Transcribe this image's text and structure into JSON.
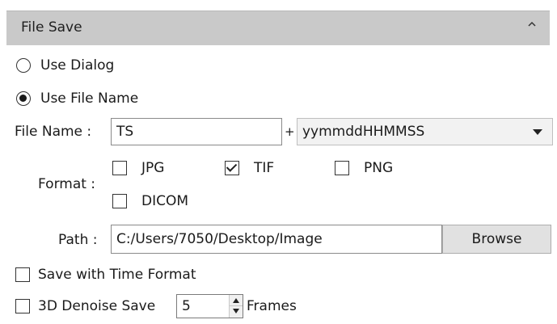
{
  "panel": {
    "title": "File Save",
    "collapse_icon": "chevron-up-icon"
  },
  "save_mode": {
    "options": [
      {
        "label": "Use Dialog",
        "checked": false
      },
      {
        "label": "Use File Name",
        "checked": true
      }
    ]
  },
  "file_name": {
    "label": "File Name :",
    "value": "TS",
    "plus": "+",
    "suffix_selected": "yymmddHHMMSS"
  },
  "format": {
    "label": "Format :",
    "options": [
      {
        "label": "JPG",
        "checked": false
      },
      {
        "label": "TIF",
        "checked": true
      },
      {
        "label": "PNG",
        "checked": false
      },
      {
        "label": "DICOM",
        "checked": false
      }
    ]
  },
  "path": {
    "label": "Path :",
    "value": "C:/Users/7050/Desktop/Image",
    "browse_label": "Browse"
  },
  "time_format": {
    "label": "Save with Time Format",
    "checked": false
  },
  "denoise": {
    "label": "3D Denoise Save",
    "checked": false,
    "frames_value": "5",
    "frames_label": "Frames"
  }
}
